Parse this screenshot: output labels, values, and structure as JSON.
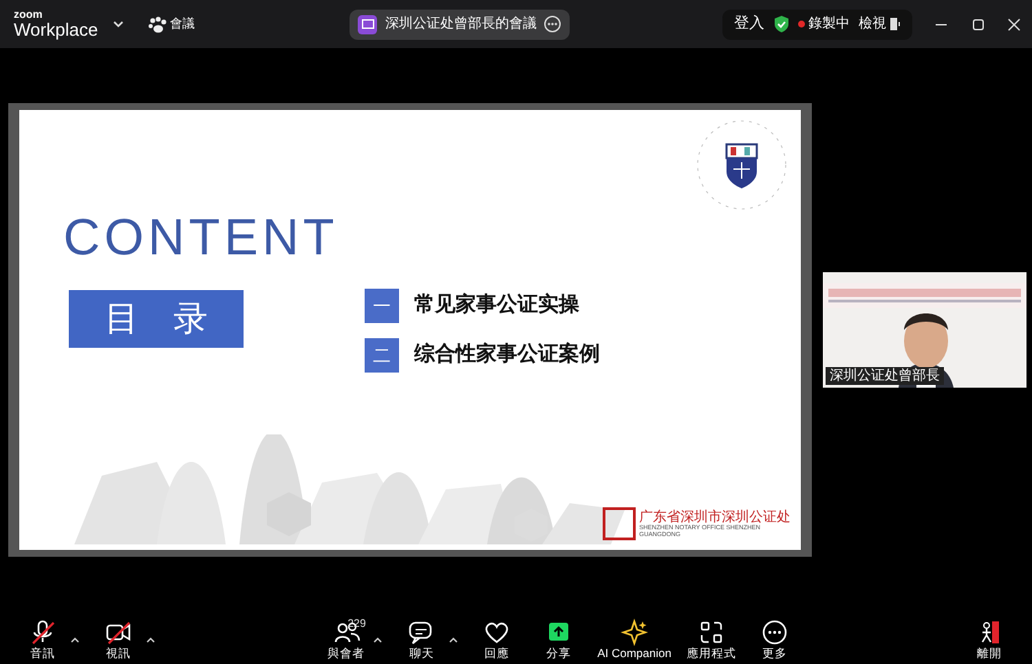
{
  "app": {
    "brand_small": "zoom",
    "brand": "Workplace",
    "meetings_label": "會議"
  },
  "meeting_title": "深圳公证处曾部長的會議",
  "top_right": {
    "sign_in": "登入",
    "recording": "錄製中",
    "recording_on": true,
    "view": "檢視"
  },
  "slide": {
    "heading": "CONTENT",
    "toc_label": "目　录",
    "items": [
      {
        "number": "一",
        "text": "常见家事公证实操"
      },
      {
        "number": "二",
        "text": "综合性家事公证案例"
      }
    ],
    "footer_cn": "广东省深圳市深圳公证处",
    "footer_en": "SHENZHEN NOTARY OFFICE SHENZHEN GUANGDONG"
  },
  "video_tile": {
    "kind": "picture",
    "name": "深圳公证处曾部長"
  },
  "toolbar": [
    {
      "kind": "mic",
      "label": "音訊",
      "muted": true,
      "caret": true
    },
    {
      "kind": "video",
      "label": "視訊",
      "muted": true,
      "caret": true
    },
    {
      "kind": "participants",
      "label": "與會者",
      "count": "229",
      "caret": true
    },
    {
      "kind": "chat",
      "label": "聊天",
      "caret": true
    },
    {
      "kind": "reactions",
      "label": "回應",
      "caret": false
    },
    {
      "kind": "share",
      "label": "分享",
      "caret": false
    },
    {
      "kind": "ai",
      "label": "AI Companion",
      "caret": false
    },
    {
      "kind": "apps",
      "label": "應用程式",
      "caret": false
    },
    {
      "kind": "more",
      "label": "更多",
      "caret": false
    }
  ],
  "leave": {
    "label": "離開"
  }
}
